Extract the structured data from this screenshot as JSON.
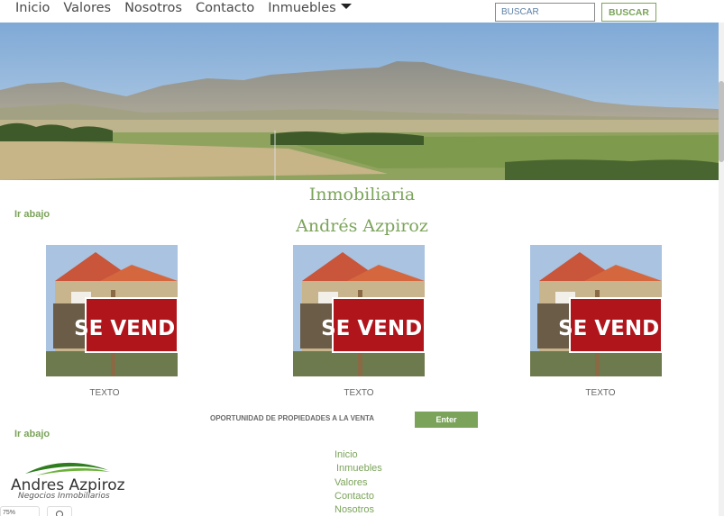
{
  "nav": {
    "items": [
      "Inicio",
      "Valores",
      "Nosotros",
      "Contacto",
      "Inmuebles"
    ],
    "search_placeholder": "BUSCAR",
    "search_button": "BUSCAR"
  },
  "page": {
    "title_line1": "Inmobiliaria",
    "title_line2": "Andrés Azpiroz",
    "ir_abajo": "Ir abajo"
  },
  "cards": [
    {
      "sign": "SE VENDE",
      "text": "TEXTO"
    },
    {
      "sign": "SE VENDE",
      "text": "TEXTO"
    },
    {
      "sign": "SE VENDE",
      "text": "TEXTO"
    }
  ],
  "cta": {
    "text": "OPORTUNIDAD DE PROPIEDADES A LA VENTA",
    "button": "Enter"
  },
  "logo": {
    "name": "Andres Azpiroz",
    "subtitle": "Negocios Inmobiliarios"
  },
  "footer_nav": [
    "Inicio",
    "Inmuebles",
    "Valores",
    "Contacto",
    "Nosotros"
  ],
  "zoom": {
    "level": "75%"
  },
  "colors": {
    "accent": "#7ba45a",
    "sign_red": "#b0151c"
  }
}
